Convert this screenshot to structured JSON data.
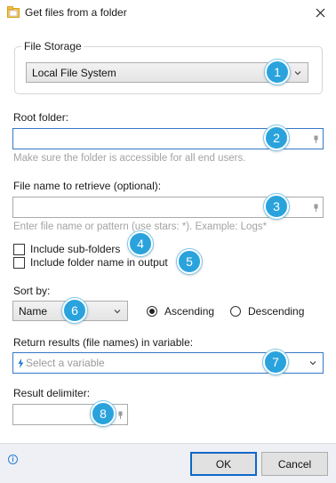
{
  "window": {
    "title": "Get files from a folder"
  },
  "file_storage": {
    "legend": "File Storage",
    "selected": "Local File System"
  },
  "root_folder": {
    "label": "Root folder:",
    "value": "",
    "hint": "Make sure the folder is accessible for all end users."
  },
  "file_name": {
    "label": "File name to retrieve (optional):",
    "value": "",
    "hint": "Enter file name or pattern (use stars: *). Example: Logs*"
  },
  "options": {
    "include_subfolders": "Include sub-folders",
    "include_folder_name": "Include folder name in output"
  },
  "sort": {
    "label": "Sort by:",
    "selected": "Name",
    "ascending": "Ascending",
    "descending": "Descending",
    "order_selected": "Ascending"
  },
  "return_results": {
    "label": "Return results (file names) in variable:",
    "placeholder": "Select a variable"
  },
  "delimiter": {
    "label": "Result delimiter:",
    "value": ""
  },
  "badges": [
    "1",
    "2",
    "3",
    "4",
    "5",
    "6",
    "7",
    "8"
  ],
  "buttons": {
    "ok": "OK",
    "cancel": "Cancel"
  },
  "colors": {
    "badge": "#2aa3dd",
    "focus_border": "#3478c6",
    "footer": "#eef0f5",
    "primary_border": "#0b68c9"
  },
  "icons": {
    "app": "folder-icon",
    "close": "close-icon",
    "info": "info-icon",
    "pin": "pin-icon",
    "variable": "lightning-icon",
    "dropdown": "chevron-down-icon"
  }
}
